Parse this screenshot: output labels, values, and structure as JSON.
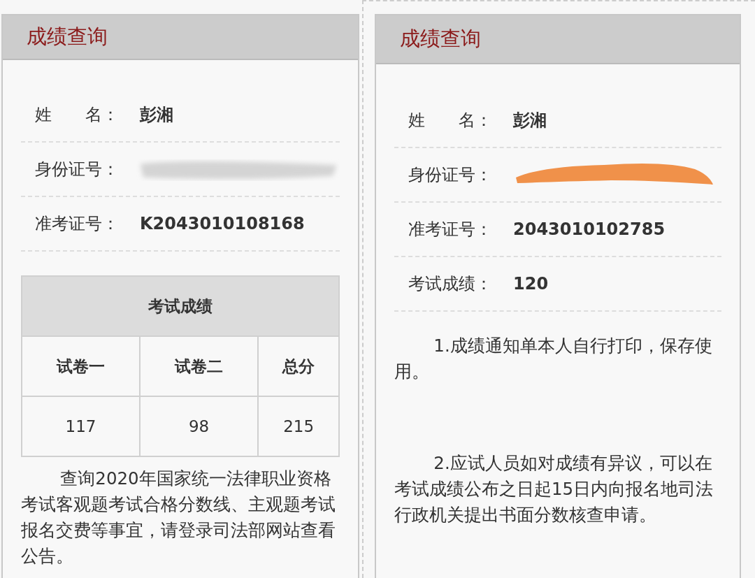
{
  "panels": [
    {
      "title": "成绩查询",
      "framed": false,
      "fields": [
        {
          "label": "姓　　名：",
          "value": "彭湘"
        },
        {
          "label": "身份证号：",
          "kind": "blurred"
        },
        {
          "label": "准考证号：",
          "value": "K2043010108168"
        }
      ],
      "score_table": {
        "caption": "考试成绩",
        "columns": [
          "试卷一",
          "试卷二",
          "总分"
        ],
        "values": [
          "117",
          "98",
          "215"
        ]
      },
      "notes": [
        "查询2020年国家统一法律职业资格考试客观题考试合格分数线、主观题考试报名交费等事宜，请登录司法部网站查看公告。"
      ]
    },
    {
      "title": "成绩查询",
      "framed": true,
      "fields": [
        {
          "label": "姓　　名：",
          "value": "彭湘"
        },
        {
          "label": "身份证号：",
          "kind": "scribbled"
        },
        {
          "label": "准考证号：",
          "value": "2043010102785"
        },
        {
          "label": "考试成绩：",
          "value": "120"
        }
      ],
      "notes": [
        "1.成绩通知单本人自行打印，保存使用。",
        "2.应试人员如对成绩有异议，可以在考试成绩公布之日起15日内向报名地司法行政机关提出书面分数核查申请。"
      ]
    }
  ]
}
